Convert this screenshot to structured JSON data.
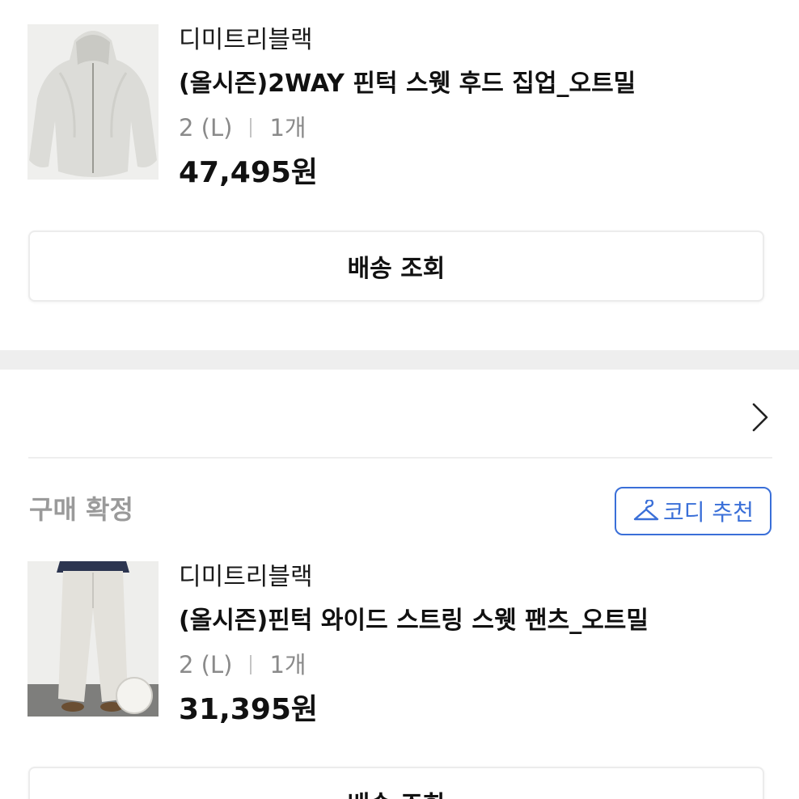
{
  "orders": [
    {
      "brand": "디미트리블랙",
      "product_name": "(올시즌)2WAY 핀턱 스웻 후드 집업_오트밀",
      "size": "2 (L)",
      "quantity": "1개",
      "price": "47,495원",
      "track_label": "배송 조회"
    },
    {
      "status": "구매 확정",
      "coordi_label": "코디 추천",
      "brand": "디미트리블랙",
      "product_name": "(올시즌)핀턱 와이드 스트링 스웻 팬츠_오트밀",
      "size": "2 (L)",
      "quantity": "1개",
      "price": "31,395원",
      "track_label": "배송 조회"
    }
  ],
  "colors": {
    "accent": "#3a6fd8",
    "muted_text": "#8a8a8a",
    "divider": "#eeeeee"
  },
  "icons": {
    "chevron": "chevron-right-icon",
    "coordi": "hanger-icon"
  }
}
